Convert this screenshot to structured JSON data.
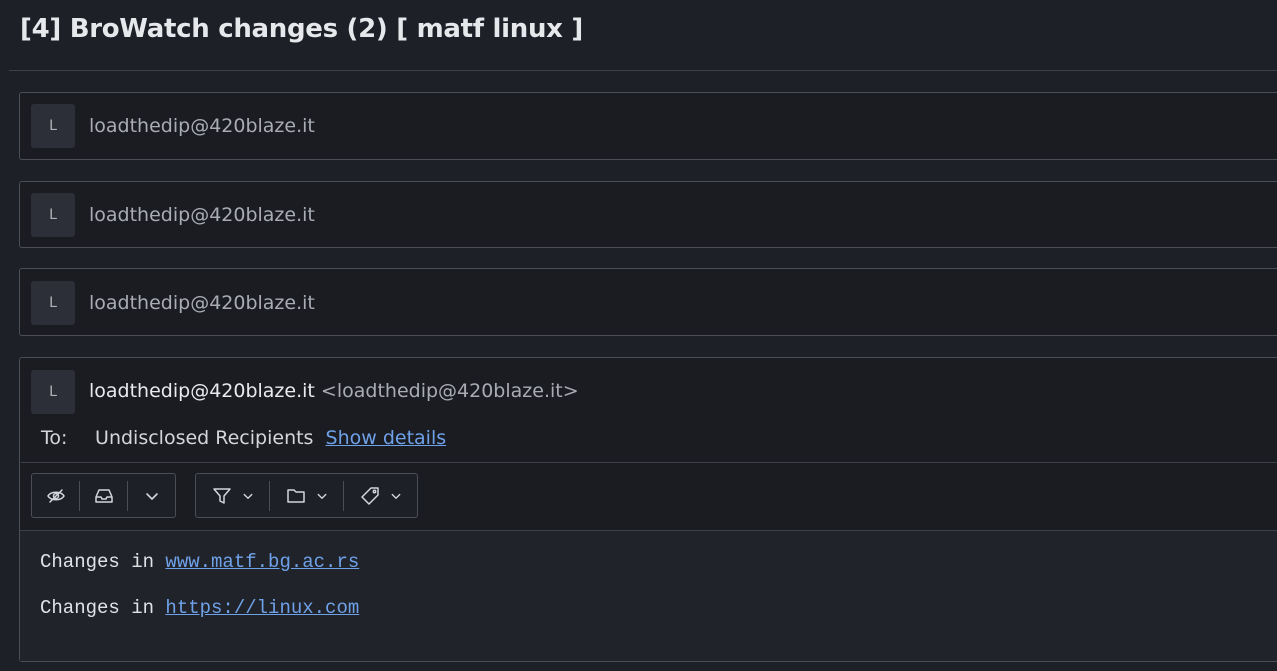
{
  "thread": {
    "title": "[4] BroWatch changes (2) [ matf linux ]"
  },
  "collapsed_messages": [
    {
      "avatar_letter": "L",
      "sender": "loadthedip@420blaze.it"
    },
    {
      "avatar_letter": "L",
      "sender": "loadthedip@420blaze.it"
    },
    {
      "avatar_letter": "L",
      "sender": "loadthedip@420blaze.it"
    }
  ],
  "expanded_message": {
    "avatar_letter": "L",
    "sender_name": "loadthedip@420blaze.it",
    "sender_email": "<loadthedip@420blaze.it>",
    "to_label": "To:",
    "to_value": "Undisclosed Recipients",
    "show_details_label": "Show details",
    "toolbar": {
      "icons": [
        "eye-slash-icon",
        "inbox-icon",
        "chevron-down-icon",
        "filter-icon",
        "folder-icon",
        "tag-icon"
      ]
    },
    "body": [
      {
        "prefix": "Changes in ",
        "link": "www.matf.bg.ac.rs"
      },
      {
        "prefix": "Changes in ",
        "link": "https://linux.com"
      }
    ]
  },
  "colors": {
    "background": "#1d2027",
    "card": "#1a1c22",
    "border": "#4a4e57",
    "link": "#6fa1e8",
    "text": "#d4d6da"
  }
}
